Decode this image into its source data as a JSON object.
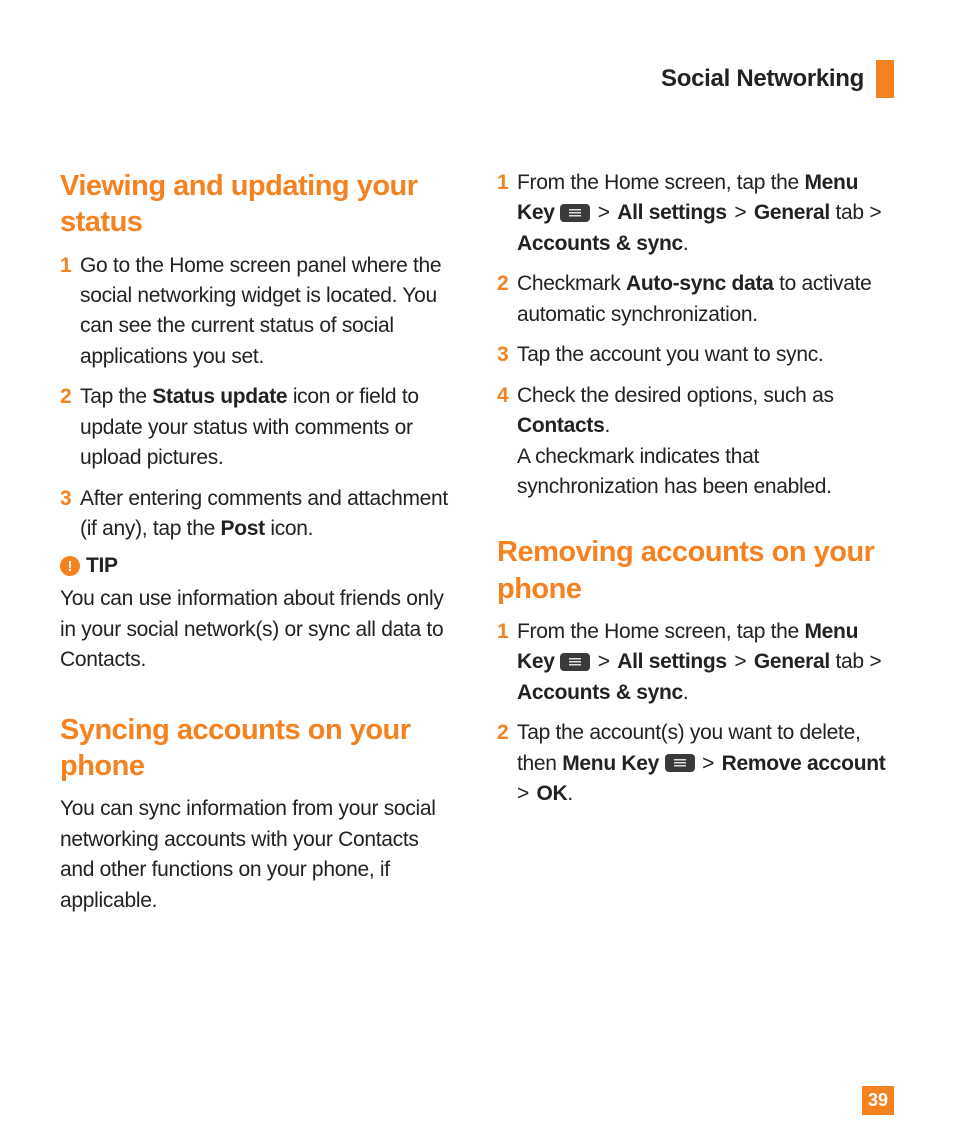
{
  "header": {
    "title": "Social Networking"
  },
  "page_number": "39",
  "sections": {
    "viewing": {
      "title": "Viewing and updating your status",
      "steps": {
        "s1": {
          "num": "1",
          "text": "Go to the Home screen panel where the social networking widget is located. You can see the current status of social applications you set."
        },
        "s2": {
          "num": "2",
          "pre": "Tap the ",
          "b1": "Status update",
          "post": " icon or field to update your status with comments or upload pictures."
        },
        "s3": {
          "num": "3",
          "pre": "After entering comments and attachment (if any), tap the ",
          "b1": "Post",
          "post": " icon."
        }
      },
      "tip": {
        "label": "TIP",
        "text": "You can use information about friends only in your social network(s) or sync all data to Contacts."
      }
    },
    "syncing": {
      "title": "Syncing accounts on your phone",
      "intro": "You can sync information from your social networking accounts with your Contacts and other functions on your phone, if applicable.",
      "steps": {
        "s1": {
          "num": "1",
          "pre": "From the Home screen, tap the ",
          "b1": "Menu Key",
          "gt1": " > ",
          "b2": "All settings",
          "gt2": "  > ",
          "b3": "General",
          "mid": " tab > ",
          "b4": "Accounts & sync",
          "post": "."
        },
        "s2": {
          "num": "2",
          "pre": "Checkmark ",
          "b1": "Auto-sync data",
          "post": " to activate automatic synchronization."
        },
        "s3": {
          "num": "3",
          "text": "Tap the account you want to sync."
        },
        "s4": {
          "num": "4",
          "pre": "Check the desired options, such as ",
          "b1": "Contacts",
          "mid": ".",
          "post2": "A checkmark indicates that synchronization has been enabled."
        }
      }
    },
    "removing": {
      "title": "Removing accounts on your phone",
      "steps": {
        "s1": {
          "num": "1",
          "pre": "From the Home screen, tap the ",
          "b1": "Menu Key",
          "gt1": " > ",
          "b2": "All settings",
          "gt2": "  > ",
          "b3": "General",
          "mid": " tab > ",
          "b4": "Accounts & sync",
          "post": "."
        },
        "s2": {
          "num": "2",
          "pre": "Tap the account(s) you want to delete, then ",
          "b1": "Menu Key",
          "gt1": " > ",
          "b2": "Remove account",
          "gt2": " > ",
          "b3": "OK",
          "post": "."
        }
      }
    }
  }
}
